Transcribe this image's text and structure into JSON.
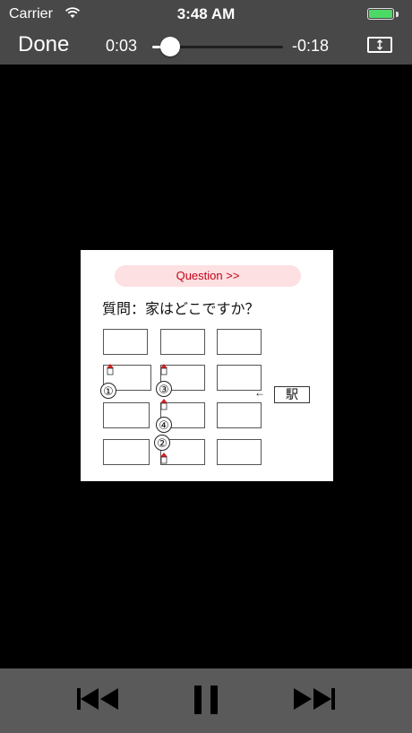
{
  "status_bar": {
    "carrier": "Carrier",
    "time": "3:48 AM",
    "wifi_icon": "wifi-icon",
    "battery_icon": "battery-icon"
  },
  "player": {
    "done_label": "Done",
    "elapsed": "0:03",
    "remaining": "-0:18",
    "progress_fraction": 0.14,
    "fit_icon": "aspect-fit-icon"
  },
  "slide": {
    "question_label": "Question >>",
    "question_text": "質問：家はどこですか？",
    "station_label": "駅",
    "arrow": "←",
    "numbers": [
      "①",
      "③",
      "④",
      "②"
    ],
    "colors": {
      "pill_bg": "#fde0e2",
      "pill_text": "#c40018",
      "house_roof": "#d42020"
    }
  },
  "controls": {
    "prev_icon": "skip-back-icon",
    "pause_icon": "pause-icon",
    "next_icon": "skip-forward-icon"
  }
}
